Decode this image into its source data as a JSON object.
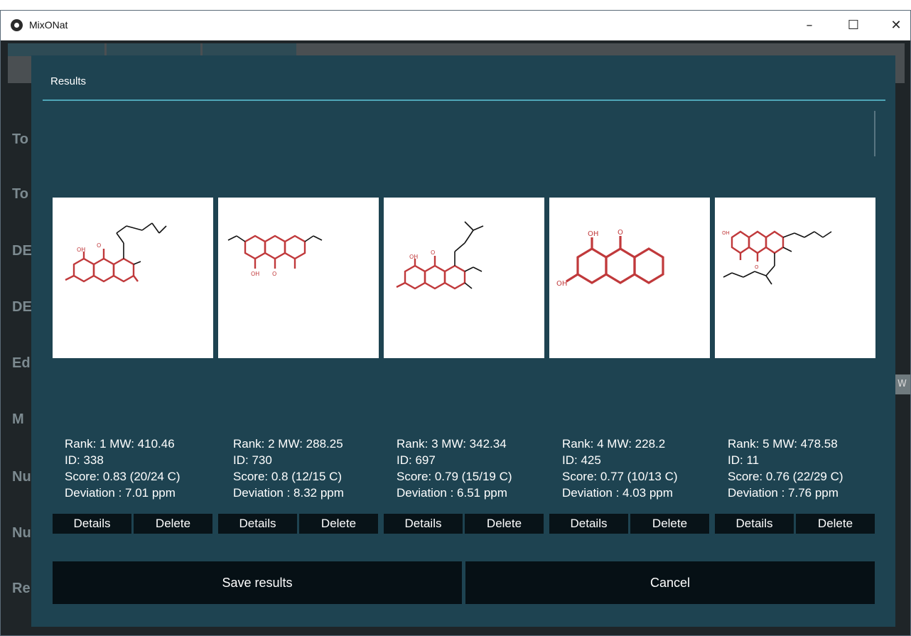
{
  "window": {
    "title": "MixONat",
    "controls": {
      "minimize": "–",
      "maximize": "☐",
      "close": "✕"
    }
  },
  "background": {
    "labels": [
      "To",
      "To",
      "DE",
      "DE",
      "Ed",
      "M",
      "Nu",
      "Nu",
      "Re"
    ],
    "right_chip": "W"
  },
  "dialog": {
    "title": "Results",
    "results": [
      {
        "line1": "Rank: 1 MW: 410.46",
        "line2": "ID: 338",
        "line3": "Score: 0.83 (20/24 C)",
        "line4": "Deviation : 7.01 ppm",
        "details": "Details",
        "delete": "Delete"
      },
      {
        "line1": "Rank: 2 MW: 288.25",
        "line2": "ID: 730",
        "line3": "Score: 0.8 (12/15 C)",
        "line4": "Deviation : 8.32 ppm",
        "details": "Details",
        "delete": "Delete"
      },
      {
        "line1": "Rank: 3 MW: 342.34",
        "line2": "ID: 697",
        "line3": "Score: 0.79 (15/19 C)",
        "line4": "Deviation : 6.51 ppm",
        "details": "Details",
        "delete": "Delete"
      },
      {
        "line1": "Rank: 4 MW: 228.2",
        "line2": "ID: 425",
        "line3": "Score: 0.77 (10/13 C)",
        "line4": "Deviation : 4.03 ppm",
        "details": "Details",
        "delete": "Delete"
      },
      {
        "line1": "Rank: 5 MW: 478.58",
        "line2": "ID: 11",
        "line3": "Score: 0.76 (22/29 C)",
        "line4": "Deviation : 7.76 ppm",
        "details": "Details",
        "delete": "Delete"
      }
    ],
    "save_label": "Save results",
    "cancel_label": "Cancel"
  },
  "structure_labels": {
    "oh": "OH",
    "o": "O"
  },
  "colors": {
    "dialog_bg": "#1e4351",
    "accent_line": "#4ea6b7",
    "button_bg": "#061015",
    "match_highlight": "#c0393b"
  }
}
